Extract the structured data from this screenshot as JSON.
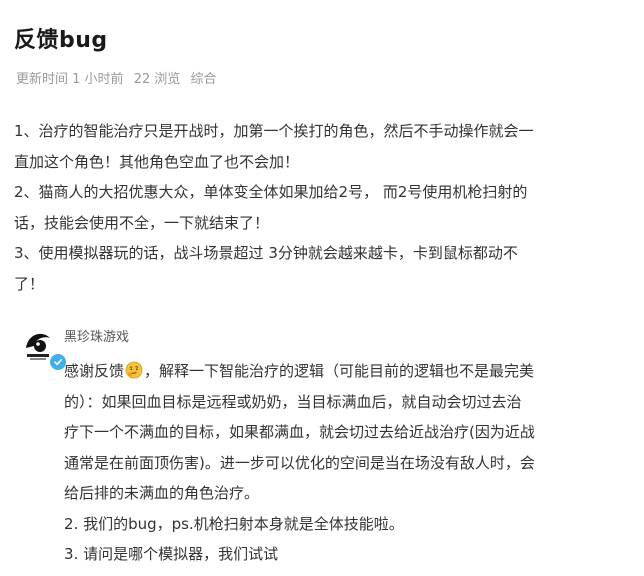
{
  "post": {
    "title": "反馈bug",
    "meta": {
      "updated": "更新时间 1 小时前",
      "views": "22 浏览",
      "category": "综合"
    },
    "body_lines": [
      "1、治疗的智能治疗只是开战时，加第一个挨打的角色，然后不手动操作就会一",
      "直加这个角色！其他角色空血了也不会加！",
      "2、猫商人的大招优惠大众，单体变全体如果加给2号， 而2号使用机枪扫射的",
      "话，技能会使用不全，一下就结束了！",
      "3、使用模拟器玩的话，战斗场景超过 3分钟就会越来越卡，卡到鼠标都动不",
      "了！"
    ]
  },
  "reply": {
    "author": "黑珍珠游戏",
    "avatar_icon": "black-pearl-logo",
    "verified_icon": "verified-check-icon",
    "verified_color": "#3fb0e8",
    "line1_before_emoji": "感谢反馈",
    "emoji": "thinking-face-emoji",
    "line1_after_emoji": "，解释一下智能治疗的逻辑（可能目前的逻辑也不是最完美",
    "lines": [
      "的）：如果回血目标是远程或奶奶，当目标满血后，就自动会切过去治",
      "疗下一个不满血的目标，如果都满血，就会切过去给近战治疗(因为近战",
      "通常是在前面顶伤害)。进一步可以优化的空间是当在场没有敌人时，会",
      "给后排的未满血的角色治疗。",
      "2. 我们的bug，ps.机枪扫射本身就是全体技能啦。",
      "3. 请问是哪个模拟器，我们试试"
    ]
  }
}
